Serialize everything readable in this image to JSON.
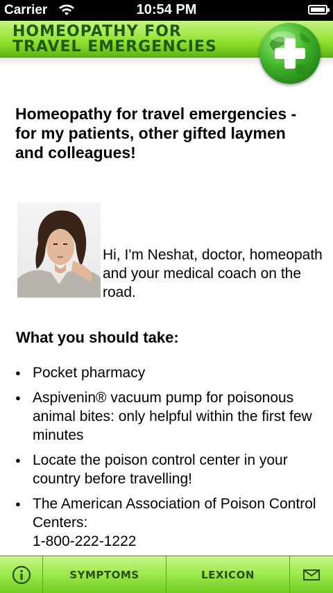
{
  "status_bar": {
    "carrier": "Carrier",
    "time": "10:54 PM"
  },
  "header": {
    "title_line1": "HOMEOPATHY FOR",
    "title_line2": "TRAVEL EMERGENCIES"
  },
  "headline": "Homeopathy for travel emergencies - for my patients, other gifted laymen and colleagues!",
  "intro": "Hi, I'm Neshat, doctor, homeopath and your medical coach on the road.",
  "section_title": "What you should take:",
  "bullets": [
    "Pocket pharmacy",
    "Aspivenin® vacuum pump for poisonous animal bites: only helpful within the first few minutes",
    "Locate the poison control center in your country before travelling!",
    "The American Association of Poison Control Centers:"
  ],
  "phone": "1-800-222-1222",
  "tabs": {
    "symptoms": "SYMPTOMS",
    "lexicon": "LEXICON"
  },
  "colors": {
    "header_green": "#8fe02c",
    "title_green": "#1f5a10",
    "tab_green": "#9be84a"
  }
}
